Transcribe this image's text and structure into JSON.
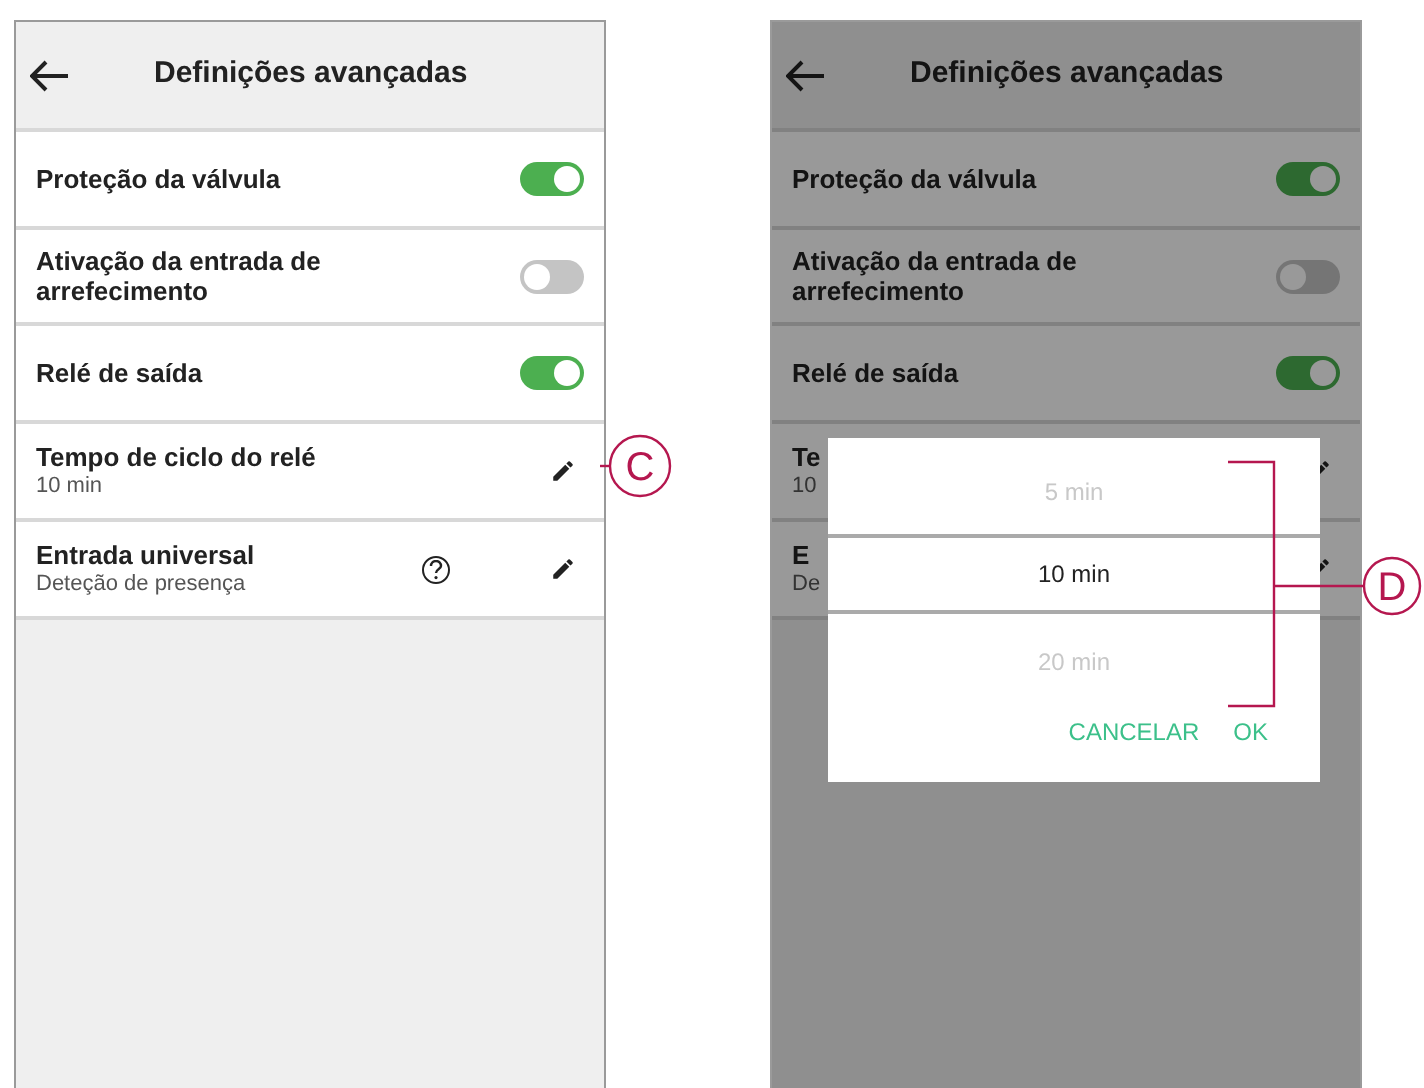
{
  "screens": [
    {
      "header": {
        "title": "Definições avançadas"
      },
      "dimmed": false,
      "settings": [
        {
          "kind": "toggle",
          "label": "Proteção da válvula",
          "on": true
        },
        {
          "kind": "toggle",
          "label": "Ativação da entrada de arrefecimento",
          "on": false
        },
        {
          "kind": "toggle",
          "label": "Relé de saída",
          "on": true
        },
        {
          "kind": "edit",
          "label": "Tempo de ciclo do relé",
          "value": "10 min",
          "help": false
        },
        {
          "kind": "edit",
          "label": "Entrada universal",
          "value": "Deteção de presença",
          "help": true
        }
      ]
    },
    {
      "header": {
        "title": "Definições avançadas"
      },
      "dimmed": true,
      "settings": [
        {
          "kind": "toggle",
          "label": "Proteção da válvula",
          "on": true
        },
        {
          "kind": "toggle",
          "label": "Ativação da entrada de arrefecimento",
          "on": false
        },
        {
          "kind": "toggle",
          "label": "Relé de saída",
          "on": true
        },
        {
          "kind": "edit",
          "label": "Te",
          "value": "10",
          "help": false
        },
        {
          "kind": "edit",
          "label": "E",
          "value": "De",
          "help": false
        }
      ]
    }
  ],
  "picker_dialog": {
    "options": [
      {
        "label": "5 min",
        "selected": false
      },
      {
        "label": "10 min",
        "selected": true
      },
      {
        "label": "20 min",
        "selected": false
      }
    ],
    "buttons": [
      "CANCELAR",
      "OK"
    ]
  },
  "callouts": [
    {
      "letter": "C"
    },
    {
      "letter": "D"
    }
  ]
}
